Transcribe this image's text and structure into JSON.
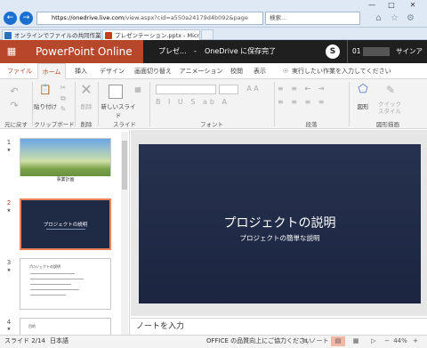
{
  "browser": {
    "back": "←",
    "forward": "→",
    "url_domain": "https://onedrive.live.com",
    "url_path": "/view.aspx?cid=a550a24179d4b092&page",
    "search_placeholder": "検索...",
    "tabs": [
      {
        "label": "オンラインでファイルの共同作業 - O...",
        "color": "#2b72c4"
      },
      {
        "label": "プレゼンテーション.pptx - Micro...",
        "color": "#c43e1c"
      }
    ]
  },
  "app": {
    "name": "PowerPoint Online",
    "filename": "プレゼ...",
    "separator": "-",
    "save_status": "OneDrive に保存完了",
    "user": "01",
    "sign_out": "サインアウト",
    "skype": "S"
  },
  "ribbon_tabs": [
    "ファイル",
    "ホーム",
    "挿入",
    "デザイン",
    "画面切り替え",
    "アニメーション",
    "校閲",
    "表示"
  ],
  "tell_me": "実行したい作業を入力してください",
  "ribbon": {
    "paste": "貼り付け",
    "delete": "削除",
    "new_slide": "新しいスライド",
    "shapes": "図形",
    "quick_styles": "クイック\nスタイル",
    "groups": [
      "元に戻す",
      "クリップボード",
      "削除",
      "スライド",
      "フォント",
      "段落",
      "図形描画"
    ]
  },
  "thumbnails": [
    {
      "num": "1",
      "title": "事業計画"
    },
    {
      "num": "2",
      "title": "プロジェクトの説明"
    },
    {
      "num": "3",
      "title": "プロジェクトの説明"
    },
    {
      "num": "4",
      "title": "目的"
    }
  ],
  "slide": {
    "title": "プロジェクトの説明",
    "subtitle": "プロジェクトの簡単な説明"
  },
  "notes_placeholder": "ノートを入力",
  "status": {
    "slide_info": "スライド 2/14",
    "language": "日本語",
    "feedback": "OFFICE の品質向上にご協力ください",
    "notes": "ノート",
    "zoom": "44%"
  }
}
